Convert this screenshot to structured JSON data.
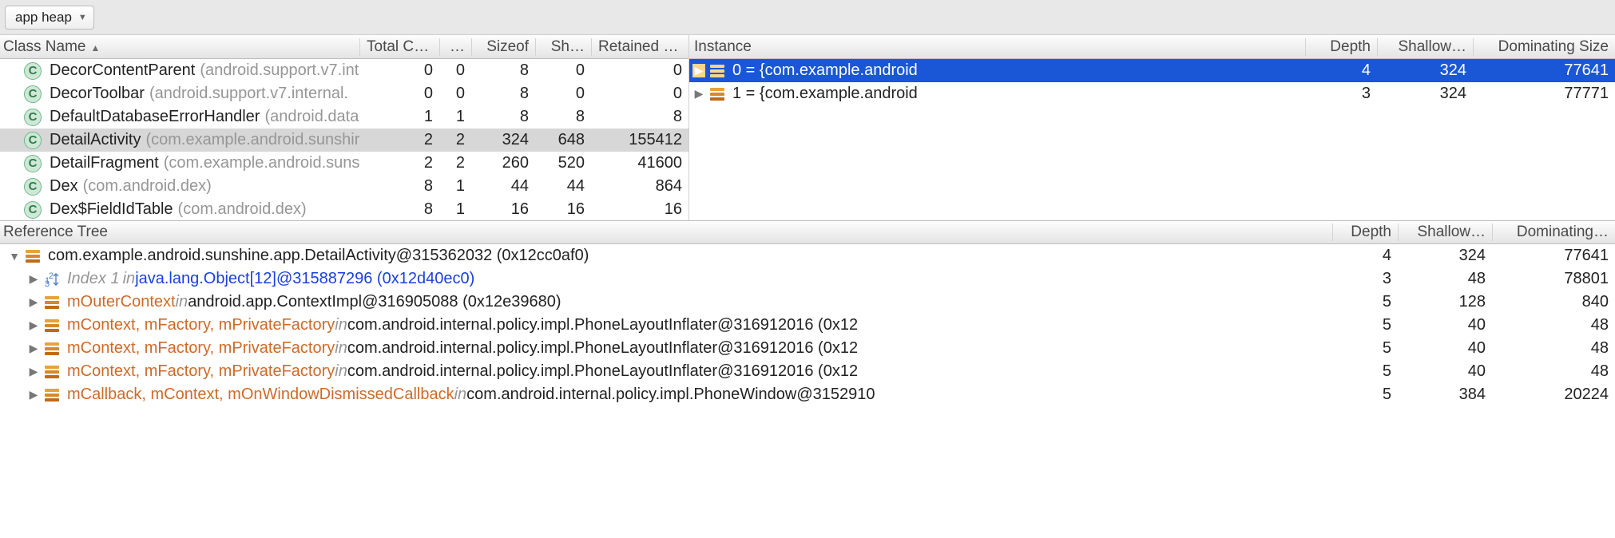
{
  "toolbar": {
    "heap_selector_label": "app heap"
  },
  "classes": {
    "headers": {
      "name": "Class Name",
      "total_count": "Total Co…",
      "heap_count": "…",
      "sizeof": "Sizeof",
      "shallow": "Sh…",
      "retained": "Retained Size"
    },
    "rows": [
      {
        "name": "DecorContentParent",
        "pkg": "(android.support.v7.int",
        "total": 0,
        "heap": 0,
        "sizeof": 8,
        "shallow": 0,
        "retained": 0,
        "selected": false
      },
      {
        "name": "DecorToolbar",
        "pkg": "(android.support.v7.internal.",
        "total": 0,
        "heap": 0,
        "sizeof": 8,
        "shallow": 0,
        "retained": 0,
        "selected": false
      },
      {
        "name": "DefaultDatabaseErrorHandler",
        "pkg": "(android.data",
        "total": 1,
        "heap": 1,
        "sizeof": 8,
        "shallow": 8,
        "retained": 8,
        "selected": false
      },
      {
        "name": "DetailActivity",
        "pkg": "(com.example.android.sunshir",
        "total": 2,
        "heap": 2,
        "sizeof": 324,
        "shallow": 648,
        "retained": 155412,
        "selected": true
      },
      {
        "name": "DetailFragment",
        "pkg": "(com.example.android.suns",
        "total": 2,
        "heap": 2,
        "sizeof": 260,
        "shallow": 520,
        "retained": 41600,
        "selected": false
      },
      {
        "name": "Dex",
        "pkg": "(com.android.dex)",
        "total": 8,
        "heap": 1,
        "sizeof": 44,
        "shallow": 44,
        "retained": 864,
        "selected": false
      },
      {
        "name": "Dex$FieldIdTable",
        "pkg": "(com.android.dex)",
        "total": 8,
        "heap": 1,
        "sizeof": 16,
        "shallow": 16,
        "retained": 16,
        "selected": false
      }
    ]
  },
  "instances": {
    "headers": {
      "instance": "Instance",
      "depth": "Depth",
      "shallow": "Shallow…",
      "dominating": "Dominating Size"
    },
    "rows": [
      {
        "label": "0 = {com.example.android",
        "depth": 4,
        "shallow": 324,
        "dominating": 77641,
        "selected": true
      },
      {
        "label": "1 = {com.example.android",
        "depth": 3,
        "shallow": 324,
        "dominating": 77771,
        "selected": false
      }
    ]
  },
  "ref": {
    "title": "Reference Tree",
    "headers": {
      "depth": "Depth",
      "shallow": "Shallow…",
      "dominating": "Dominating…"
    },
    "rows": [
      {
        "indent": 0,
        "open": true,
        "icon": "bars",
        "html": [
          {
            "t": "plain",
            "v": "com.example.android.sunshine.app.DetailActivity@315362032 (0x12cc0af0)"
          }
        ],
        "depth": 4,
        "shallow": 324,
        "dominating": 77641
      },
      {
        "indent": 1,
        "open": false,
        "icon": "array",
        "html": [
          {
            "t": "idx",
            "v": "Index 1"
          },
          {
            "t": "in",
            "v": " in "
          },
          {
            "t": "link",
            "v": "java.lang.Object[12]@315887296 (0x12d40ec0)"
          }
        ],
        "depth": 3,
        "shallow": 48,
        "dominating": 78801
      },
      {
        "indent": 1,
        "open": false,
        "icon": "bars",
        "html": [
          {
            "t": "field",
            "v": "mOuterContext"
          },
          {
            "t": "in",
            "v": " in "
          },
          {
            "t": "plain",
            "v": "android.app.ContextImpl@316905088 (0x12e39680)"
          }
        ],
        "depth": 5,
        "shallow": 128,
        "dominating": 840
      },
      {
        "indent": 1,
        "open": false,
        "icon": "bars",
        "html": [
          {
            "t": "field",
            "v": "mContext, mFactory, mPrivateFactory"
          },
          {
            "t": "in",
            "v": " in "
          },
          {
            "t": "plain",
            "v": "com.android.internal.policy.impl.PhoneLayoutInflater@316912016 (0x12"
          }
        ],
        "depth": 5,
        "shallow": 40,
        "dominating": 48
      },
      {
        "indent": 1,
        "open": false,
        "icon": "bars",
        "html": [
          {
            "t": "field",
            "v": "mContext, mFactory, mPrivateFactory"
          },
          {
            "t": "in",
            "v": " in "
          },
          {
            "t": "plain",
            "v": "com.android.internal.policy.impl.PhoneLayoutInflater@316912016 (0x12"
          }
        ],
        "depth": 5,
        "shallow": 40,
        "dominating": 48
      },
      {
        "indent": 1,
        "open": false,
        "icon": "bars",
        "html": [
          {
            "t": "field",
            "v": "mContext, mFactory, mPrivateFactory"
          },
          {
            "t": "in",
            "v": " in "
          },
          {
            "t": "plain",
            "v": "com.android.internal.policy.impl.PhoneLayoutInflater@316912016 (0x12"
          }
        ],
        "depth": 5,
        "shallow": 40,
        "dominating": 48
      },
      {
        "indent": 1,
        "open": false,
        "icon": "bars",
        "html": [
          {
            "t": "field",
            "v": "mCallback, mContext, mOnWindowDismissedCallback"
          },
          {
            "t": "in",
            "v": " in "
          },
          {
            "t": "plain",
            "v": "com.android.internal.policy.impl.PhoneWindow@3152910"
          }
        ],
        "depth": 5,
        "shallow": 384,
        "dominating": 20224
      }
    ]
  }
}
